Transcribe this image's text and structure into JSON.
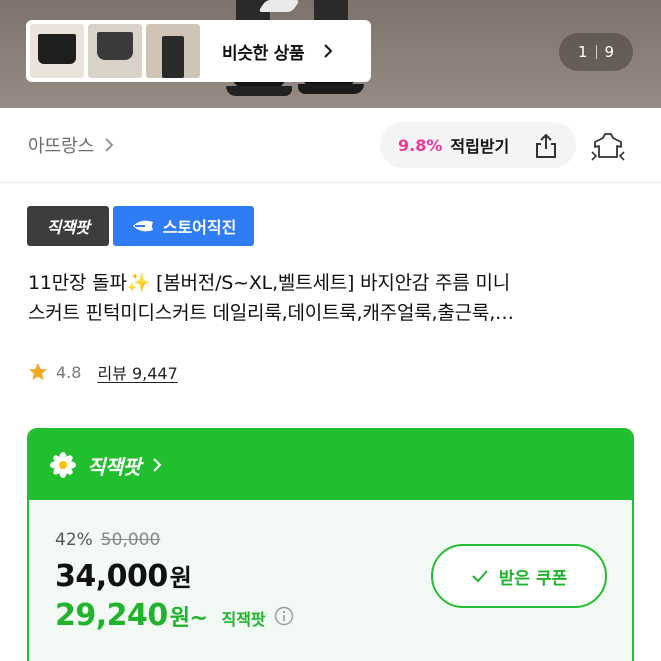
{
  "hero": {
    "similar_label": "비슷한 상품",
    "pager_current": "1",
    "pager_total": "9"
  },
  "shop": {
    "name": "아뜨랑스",
    "points_pct": "9.8%",
    "points_label": "적립받기"
  },
  "badges": {
    "direct": "직잭팟",
    "store": "스토어직진"
  },
  "product": {
    "title_line1": "11만장 돌파✨ [봄버전/S~XL,벨트세트] 바지안감 주름 미니",
    "title_line2": "스커트 핀턱미디스커트 데일리룩,데이트룩,캐주얼룩,출근룩,…",
    "rating": "4.8",
    "review_label": "리뷰 9,447"
  },
  "deal": {
    "brand": "직잭팟",
    "discount_pct": "42%",
    "original_price": "50,000",
    "price": "34,000",
    "price_unit": "원",
    "deal_price": "29,240",
    "deal_price_unit": "원~",
    "deal_tag": "직잭팟",
    "coupon_label": "받은 쿠폰"
  },
  "colors": {
    "accent_green": "#21be2f",
    "points_pink": "#f0379a",
    "store_blue": "#2f7df6"
  }
}
